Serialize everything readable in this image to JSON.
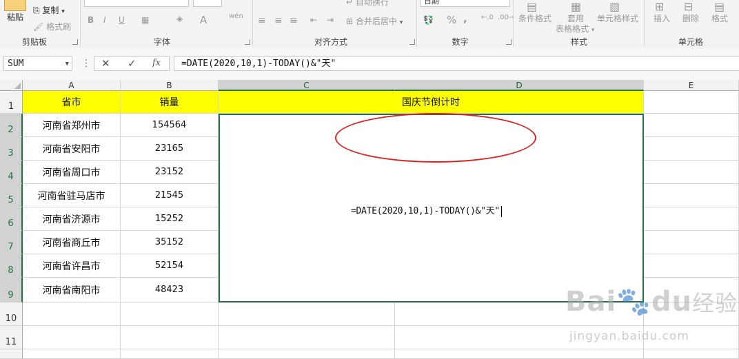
{
  "ribbon": {
    "clipboard": {
      "paste": "粘贴",
      "copy": "复制",
      "format_painter": "格式刷",
      "group": "剪贴板"
    },
    "font": {
      "group": "字体",
      "bold": "B",
      "italic": "I",
      "underline": "U",
      "color": "A",
      "wen": "wén"
    },
    "alignment": {
      "wrap": "自动换行",
      "merge": "合并后居中",
      "group": "对齐方式"
    },
    "number": {
      "format": "日期",
      "percent": "%",
      "comma": ",",
      "group": "数字"
    },
    "styles": {
      "conditional": "条件格式",
      "table_fmt_1": "套用",
      "table_fmt_2": "表格格式",
      "cell_styles": "单元格样式",
      "group": "样式"
    },
    "cells": {
      "insert": "插入",
      "delete": "删除",
      "format": "格式",
      "group": "单元格"
    }
  },
  "formula_bar": {
    "name_box": "SUM",
    "cancel_icon": "✕",
    "enter_icon": "✓",
    "fx": "fx",
    "formula": "=DATE(2020,10,1)-TODAY()&\"天\""
  },
  "columns": [
    "A",
    "B",
    "C",
    "D",
    "E"
  ],
  "rows": [
    "1",
    "2",
    "3",
    "4",
    "5",
    "6",
    "7",
    "8",
    "9",
    "10",
    "11"
  ],
  "sheet": {
    "header": {
      "province": "省市",
      "sales": "销量",
      "countdown": "国庆节倒计时"
    },
    "data": [
      {
        "city": "河南省郑州市",
        "sales": "154564"
      },
      {
        "city": "河南省安阳市",
        "sales": "23165"
      },
      {
        "city": "河南省周口市",
        "sales": "23152"
      },
      {
        "city": "河南省驻马店市",
        "sales": "21545"
      },
      {
        "city": "河南省济源市",
        "sales": "15252"
      },
      {
        "city": "河南省商丘市",
        "sales": "35152"
      },
      {
        "city": "河南省许昌市",
        "sales": "52154"
      },
      {
        "city": "河南省南阳市",
        "sales": "48423"
      }
    ],
    "editing_text": "=DATE(2020,10,1)-TODAY()&\"天\""
  },
  "watermark": {
    "brand": "Bai",
    "brand2": "du",
    "cn": "经验",
    "url": "jingyan.baidu.com"
  },
  "colors": {
    "header_fill": "#ffff00",
    "selection": "#217346",
    "annotation": "#e0201f"
  }
}
